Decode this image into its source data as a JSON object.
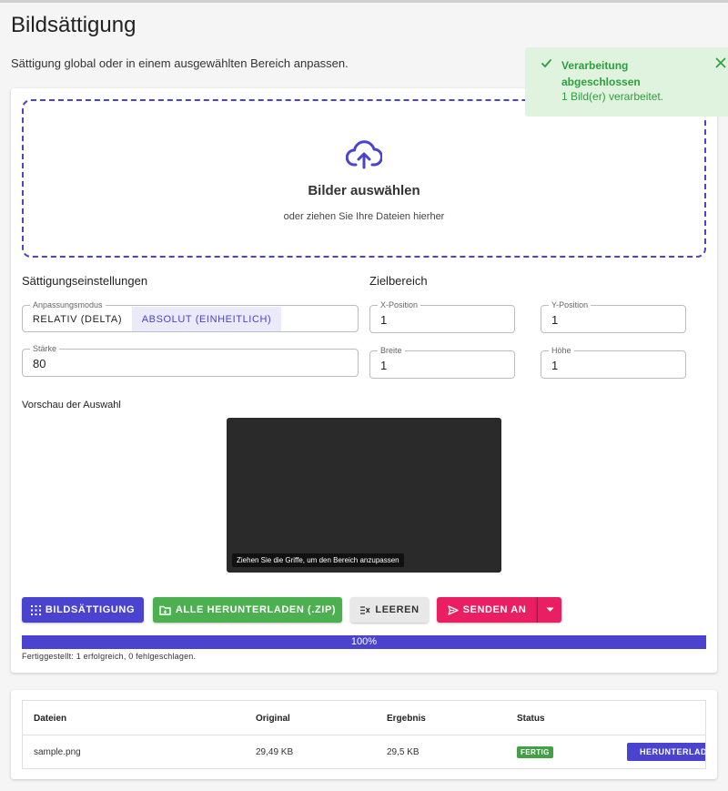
{
  "page": {
    "title": "Bildsättigung",
    "subtitle": "Sättigung global oder in einem ausgewählten Bereich anpassen."
  },
  "dropzone": {
    "title": "Bilder auswählen",
    "subtitle": "oder ziehen Sie Ihre Dateien hierher",
    "icon": "cloud-upload-icon"
  },
  "settings": {
    "heading": "Sättigungseinstellungen",
    "mode_legend": "Anpassungsmodus",
    "mode_options": [
      "RELATIV (DELTA)",
      "ABSOLUT (EINHEITLICH)"
    ],
    "mode_selected": "ABSOLUT (EINHEITLICH)",
    "strength_legend": "Stärke",
    "strength_value": "80"
  },
  "target": {
    "heading": "Zielbereich",
    "x_legend": "X-Position",
    "x_value": "1",
    "y_legend": "Y-Position",
    "y_value": "1",
    "width_legend": "Breite",
    "width_value": "1",
    "height_legend": "Höhe",
    "height_value": "1"
  },
  "preview": {
    "heading": "Vorschau der Auswahl",
    "hint": "Ziehen Sie die Griffe, um den Bereich anzupassen"
  },
  "actions": {
    "process_label": "BILDSÄTTIGUNG",
    "download_all_label": "ALLE HERUNTERLADEN (.ZIP)",
    "clear_label": "LEEREN",
    "send_label": "SENDEN AN"
  },
  "progress": {
    "value_percent": 100,
    "label": "100%",
    "status_text": "Fertiggestellt: 1 erfolgreich, 0 fehlgeschlagen."
  },
  "files_table": {
    "headers": [
      "Dateien",
      "Original",
      "Ergebnis",
      "Status"
    ],
    "rows": [
      {
        "name": "sample.png",
        "original": "29,49 KB",
        "result": "29,5 KB",
        "status": "FERTIG",
        "action": "HERUNTERLADEN"
      }
    ]
  },
  "toast": {
    "title": "Verarbeitung abgeschlossen",
    "message": "1 Bild(er) verarbeitet."
  },
  "colors": {
    "primary": "#4a43cf",
    "success": "#4caf50",
    "accent": "#e91e63",
    "toast_bg": "#dff3df"
  }
}
